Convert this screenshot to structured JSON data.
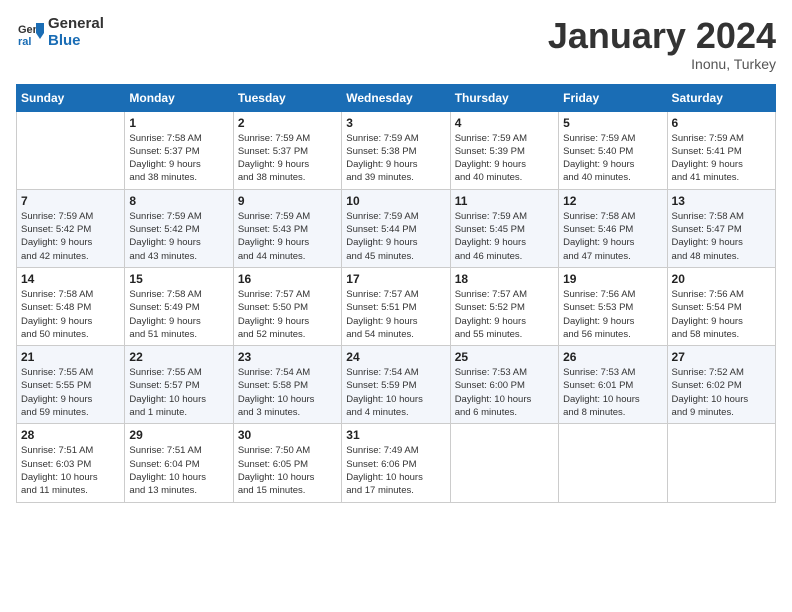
{
  "header": {
    "logo_line1": "General",
    "logo_line2": "Blue",
    "month_title": "January 2024",
    "subtitle": "Inonu, Turkey"
  },
  "weekdays": [
    "Sunday",
    "Monday",
    "Tuesday",
    "Wednesday",
    "Thursday",
    "Friday",
    "Saturday"
  ],
  "weeks": [
    [
      {
        "day": "",
        "info": ""
      },
      {
        "day": "1",
        "info": "Sunrise: 7:58 AM\nSunset: 5:37 PM\nDaylight: 9 hours\nand 38 minutes."
      },
      {
        "day": "2",
        "info": "Sunrise: 7:59 AM\nSunset: 5:37 PM\nDaylight: 9 hours\nand 38 minutes."
      },
      {
        "day": "3",
        "info": "Sunrise: 7:59 AM\nSunset: 5:38 PM\nDaylight: 9 hours\nand 39 minutes."
      },
      {
        "day": "4",
        "info": "Sunrise: 7:59 AM\nSunset: 5:39 PM\nDaylight: 9 hours\nand 40 minutes."
      },
      {
        "day": "5",
        "info": "Sunrise: 7:59 AM\nSunset: 5:40 PM\nDaylight: 9 hours\nand 40 minutes."
      },
      {
        "day": "6",
        "info": "Sunrise: 7:59 AM\nSunset: 5:41 PM\nDaylight: 9 hours\nand 41 minutes."
      }
    ],
    [
      {
        "day": "7",
        "info": "Sunrise: 7:59 AM\nSunset: 5:42 PM\nDaylight: 9 hours\nand 42 minutes."
      },
      {
        "day": "8",
        "info": "Sunrise: 7:59 AM\nSunset: 5:42 PM\nDaylight: 9 hours\nand 43 minutes."
      },
      {
        "day": "9",
        "info": "Sunrise: 7:59 AM\nSunset: 5:43 PM\nDaylight: 9 hours\nand 44 minutes."
      },
      {
        "day": "10",
        "info": "Sunrise: 7:59 AM\nSunset: 5:44 PM\nDaylight: 9 hours\nand 45 minutes."
      },
      {
        "day": "11",
        "info": "Sunrise: 7:59 AM\nSunset: 5:45 PM\nDaylight: 9 hours\nand 46 minutes."
      },
      {
        "day": "12",
        "info": "Sunrise: 7:58 AM\nSunset: 5:46 PM\nDaylight: 9 hours\nand 47 minutes."
      },
      {
        "day": "13",
        "info": "Sunrise: 7:58 AM\nSunset: 5:47 PM\nDaylight: 9 hours\nand 48 minutes."
      }
    ],
    [
      {
        "day": "14",
        "info": "Sunrise: 7:58 AM\nSunset: 5:48 PM\nDaylight: 9 hours\nand 50 minutes."
      },
      {
        "day": "15",
        "info": "Sunrise: 7:58 AM\nSunset: 5:49 PM\nDaylight: 9 hours\nand 51 minutes."
      },
      {
        "day": "16",
        "info": "Sunrise: 7:57 AM\nSunset: 5:50 PM\nDaylight: 9 hours\nand 52 minutes."
      },
      {
        "day": "17",
        "info": "Sunrise: 7:57 AM\nSunset: 5:51 PM\nDaylight: 9 hours\nand 54 minutes."
      },
      {
        "day": "18",
        "info": "Sunrise: 7:57 AM\nSunset: 5:52 PM\nDaylight: 9 hours\nand 55 minutes."
      },
      {
        "day": "19",
        "info": "Sunrise: 7:56 AM\nSunset: 5:53 PM\nDaylight: 9 hours\nand 56 minutes."
      },
      {
        "day": "20",
        "info": "Sunrise: 7:56 AM\nSunset: 5:54 PM\nDaylight: 9 hours\nand 58 minutes."
      }
    ],
    [
      {
        "day": "21",
        "info": "Sunrise: 7:55 AM\nSunset: 5:55 PM\nDaylight: 9 hours\nand 59 minutes."
      },
      {
        "day": "22",
        "info": "Sunrise: 7:55 AM\nSunset: 5:57 PM\nDaylight: 10 hours\nand 1 minute."
      },
      {
        "day": "23",
        "info": "Sunrise: 7:54 AM\nSunset: 5:58 PM\nDaylight: 10 hours\nand 3 minutes."
      },
      {
        "day": "24",
        "info": "Sunrise: 7:54 AM\nSunset: 5:59 PM\nDaylight: 10 hours\nand 4 minutes."
      },
      {
        "day": "25",
        "info": "Sunrise: 7:53 AM\nSunset: 6:00 PM\nDaylight: 10 hours\nand 6 minutes."
      },
      {
        "day": "26",
        "info": "Sunrise: 7:53 AM\nSunset: 6:01 PM\nDaylight: 10 hours\nand 8 minutes."
      },
      {
        "day": "27",
        "info": "Sunrise: 7:52 AM\nSunset: 6:02 PM\nDaylight: 10 hours\nand 9 minutes."
      }
    ],
    [
      {
        "day": "28",
        "info": "Sunrise: 7:51 AM\nSunset: 6:03 PM\nDaylight: 10 hours\nand 11 minutes."
      },
      {
        "day": "29",
        "info": "Sunrise: 7:51 AM\nSunset: 6:04 PM\nDaylight: 10 hours\nand 13 minutes."
      },
      {
        "day": "30",
        "info": "Sunrise: 7:50 AM\nSunset: 6:05 PM\nDaylight: 10 hours\nand 15 minutes."
      },
      {
        "day": "31",
        "info": "Sunrise: 7:49 AM\nSunset: 6:06 PM\nDaylight: 10 hours\nand 17 minutes."
      },
      {
        "day": "",
        "info": ""
      },
      {
        "day": "",
        "info": ""
      },
      {
        "day": "",
        "info": ""
      }
    ]
  ]
}
